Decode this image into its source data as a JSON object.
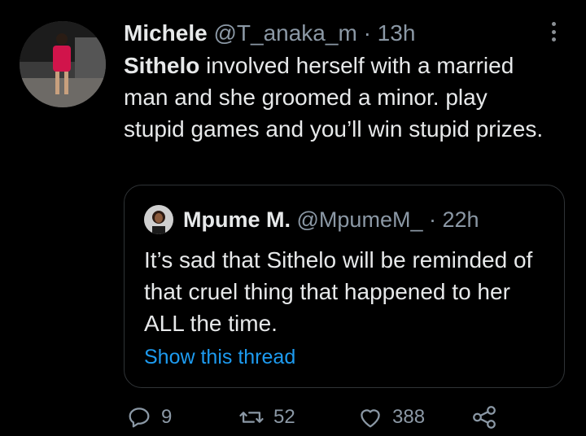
{
  "tweet": {
    "display_name": "Michele",
    "handle": "@T_anaka_m",
    "separator": "·",
    "time": "13h",
    "text_bold": "Sithelo",
    "text_rest": " involved herself with a married man and she groomed a minor.  play stupid games and you’ll win stupid prizes."
  },
  "quote": {
    "display_name": "Mpume M.",
    "handle": "@MpumeM_",
    "separator": "·",
    "time": "22h",
    "text": "It’s sad that Sithelo will be reminded of that cruel thing that happened to her ALL the time.",
    "show_thread": "Show this thread"
  },
  "actions": {
    "reply_count": "9",
    "retweet_count": "52",
    "like_count": "388"
  },
  "icons": {
    "more": "more-vertical-icon",
    "reply": "reply-icon",
    "retweet": "retweet-icon",
    "like": "heart-icon",
    "share": "share-icon"
  },
  "colors": {
    "background": "#000000",
    "text": "#e7e9ea",
    "secondary": "#8b98a5",
    "link": "#1d9bf0",
    "border": "#2f3336"
  }
}
